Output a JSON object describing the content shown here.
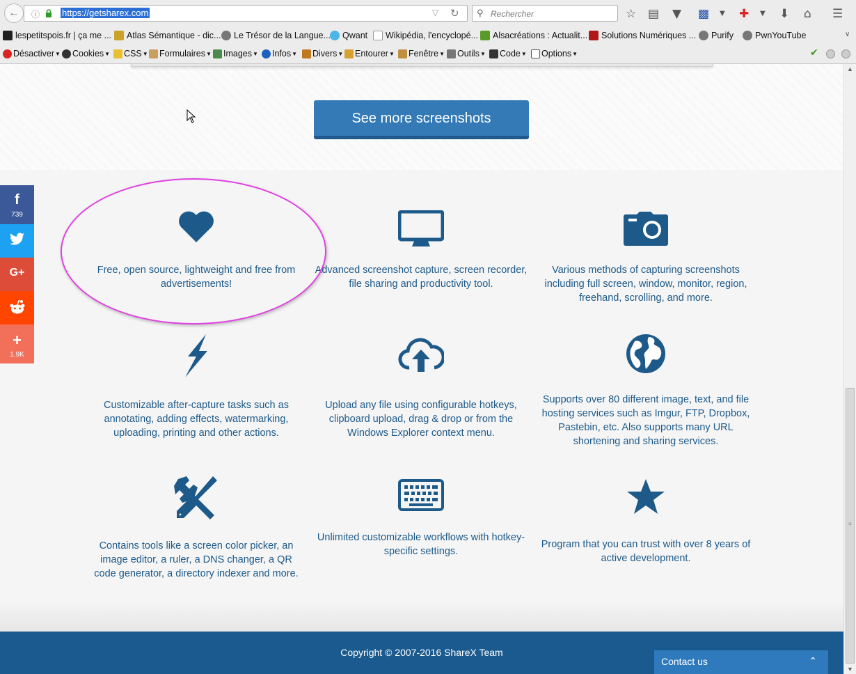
{
  "browser": {
    "url": "https://getsharex.com",
    "search_placeholder": "Rechercher",
    "bookmarks": [
      "lespetitspois.fr | ça me ...",
      "Atlas Sémantique - dic...",
      "Le Trésor de la Langue...",
      "Qwant",
      "Wikipédia, l'encyclopé...",
      "Alsacréations : Actualit...",
      "Solutions Numériques ...",
      "Purify",
      "PwnYouTube"
    ],
    "devtools": [
      "Désactiver",
      "Cookies",
      "CSS",
      "Formulaires",
      "Images",
      "Infos",
      "Divers",
      "Entourer",
      "Fenêtre",
      "Outils",
      "Code",
      "Options"
    ]
  },
  "page": {
    "see_more_label": "See more screenshots",
    "features": [
      {
        "icon": "heart-icon",
        "text": "Free, open source, lightweight and free from advertisements!"
      },
      {
        "icon": "monitor-icon",
        "text": "Advanced screenshot capture, screen recorder, file sharing and productivity tool."
      },
      {
        "icon": "camera-icon",
        "text": "Various methods of capturing screenshots including full screen, window, monitor, region, freehand, scrolling, and more."
      },
      {
        "icon": "lightning-icon",
        "text": "Customizable after-capture tasks such as annotating, adding effects, watermarking, uploading, printing and other actions."
      },
      {
        "icon": "cloud-upload-icon",
        "text": "Upload any file using configurable hotkeys, clipboard upload, drag & drop or from the Windows Explorer context menu."
      },
      {
        "icon": "globe-icon",
        "text": "Supports over 80 different image, text, and file hosting services such as Imgur, FTP, Dropbox, Pastebin, etc. Also supports many URL shortening and sharing services."
      },
      {
        "icon": "tools-icon",
        "text": "Contains tools like a screen color picker, an image editor, a ruler, a DNS changer, a QR code generator, a directory indexer and more."
      },
      {
        "icon": "keyboard-icon",
        "text": "Unlimited customizable workflows with hotkey-specific settings."
      },
      {
        "icon": "star-icon",
        "text": "Program that you can trust with over 8 years of active development."
      }
    ],
    "footer_copyright": "Copyright © 2007-2016 ShareX Team",
    "contact_label": "Contact us"
  },
  "share": {
    "facebook_count": "739",
    "more_count": "1.9K",
    "colors": {
      "facebook": "#3b5998",
      "twitter": "#1da1f2",
      "google": "#dd4b39",
      "reddit": "#ff4500",
      "more": "#f26f5a"
    }
  },
  "colors": {
    "accent": "#337ab7",
    "icon_blue": "#1d5a8a",
    "footer": "#1a5a8e",
    "highlight": "#e040e0"
  }
}
